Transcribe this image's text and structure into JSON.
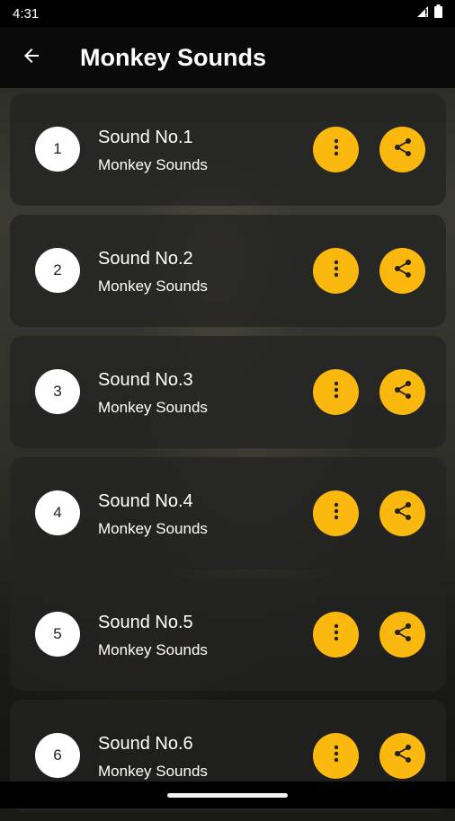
{
  "status_bar": {
    "time": "4:31",
    "icons": [
      "signal-icon",
      "battery-icon"
    ]
  },
  "app_bar": {
    "back_icon": "arrow-back-icon",
    "title": "Monkey Sounds"
  },
  "sounds": [
    {
      "number": "1",
      "title": "Sound No.1",
      "subtitle": "Monkey Sounds"
    },
    {
      "number": "2",
      "title": "Sound No.2",
      "subtitle": "Monkey Sounds"
    },
    {
      "number": "3",
      "title": "Sound No.3",
      "subtitle": "Monkey Sounds"
    },
    {
      "number": "4",
      "title": "Sound No.4",
      "subtitle": "Monkey Sounds"
    },
    {
      "number": "5",
      "title": "Sound No.5",
      "subtitle": "Monkey Sounds"
    },
    {
      "number": "6",
      "title": "Sound No.6",
      "subtitle": "Monkey Sounds"
    }
  ],
  "item_actions": {
    "more_icon": "more-vert-icon",
    "share_icon": "share-icon"
  },
  "colors": {
    "accent": "#fbb80f",
    "app_bar": "#080808",
    "card": "#232321",
    "number_circle": "#ffffff"
  }
}
